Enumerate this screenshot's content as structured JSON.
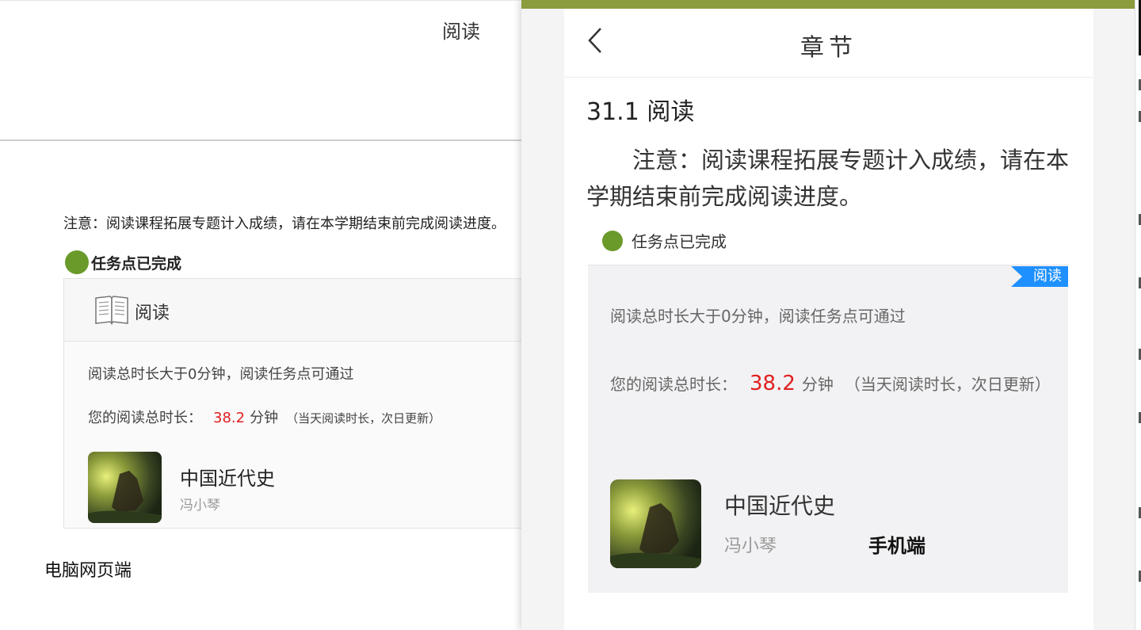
{
  "desktop": {
    "title": "阅读",
    "notice": "注意：阅读课程拓展专题计入成绩，请在本学期结束前完成阅读进度。",
    "status_text": "任务点已完成",
    "status_color": "#6a9a2a",
    "card": {
      "header_icon": "open-book-icon",
      "header_label": "阅读",
      "rule_text": "阅读总时长大于0分钟，阅读任务点可通过",
      "duration_label": "您的阅读总时长：",
      "duration_value": "38.2",
      "duration_unit": "分钟",
      "duration_note": "（当天阅读时长，次日更新）",
      "book_title": "中国近代史",
      "book_author": "冯小琴"
    },
    "caption": "电脑网页端"
  },
  "phone": {
    "accent_color": "#8b9c3e",
    "nav_back_icon": "chevron-left-icon",
    "nav_title": "章节",
    "section_heading": "31.1 阅读",
    "notice": "注意：阅读课程拓展专题计入成绩，请在本学期结束前完成阅读进度。",
    "status_text": "任务点已完成",
    "card": {
      "badge": "阅读",
      "badge_color": "#1e90ff",
      "rule_text": "阅读总时长大于0分钟，阅读任务点可通过",
      "duration_label": "您的阅读总时长：",
      "duration_value": "38.2",
      "duration_unit": "分钟",
      "duration_note": "（当天阅读时长，次日更新）",
      "book_title": "中国近代史",
      "book_author": "冯小琴"
    },
    "caption": "手机端"
  }
}
